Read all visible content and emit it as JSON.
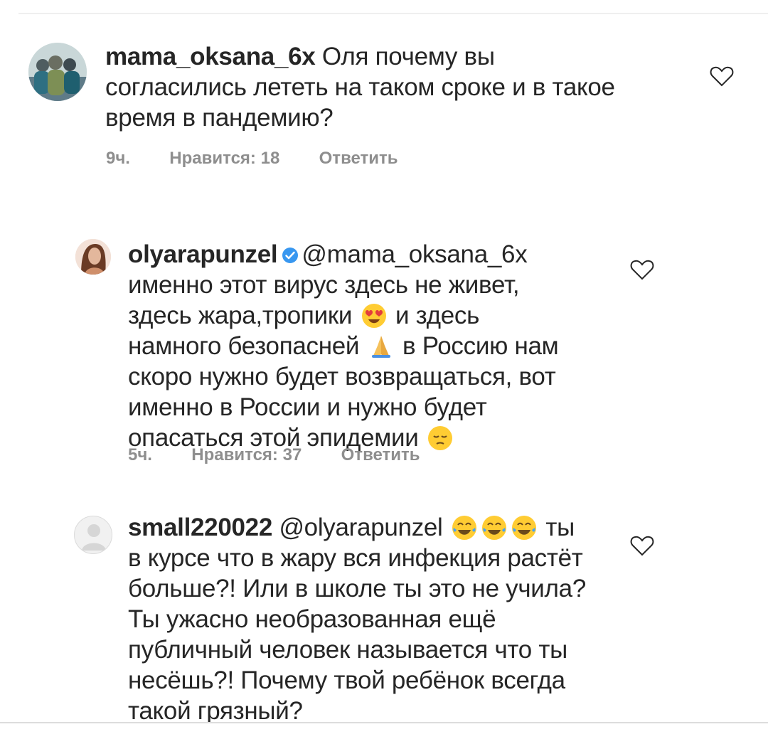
{
  "comments": [
    {
      "username": "mama_oksana_6x",
      "text_lines": [
        " Оля почему вы",
        "согласились лететь на таком сроке и в такое",
        "время в пандемию?"
      ],
      "time": "9ч.",
      "likes": "Нравится: 18",
      "reply": "Ответить",
      "avatar_icon": "profile-photo-group",
      "like_icon": "heart-outline-icon"
    },
    {
      "username": "olyarapunzel",
      "mention": "@mama_oksana_6x",
      "text_lines": [
        "именно этот вирус здесь не живет,",
        "здесь жара,тропики",
        "и здесь",
        "намного безопасней",
        "в Россию нам",
        "скоро нужно будет возвращаться, вот",
        "именно в России и нужно будет",
        "опасаться этой эпидемии"
      ],
      "time": "5ч.",
      "likes": "Нравится: 37",
      "reply": "Ответить",
      "avatar_icon": "profile-photo-woman",
      "verified_icon": "verified-badge-icon",
      "emojis": [
        "heart-eyes-emoji-icon",
        "folded-hands-emoji-icon",
        "pensive-face-emoji-icon"
      ],
      "like_icon": "heart-outline-icon"
    },
    {
      "username": "small220022",
      "mention": "@olyarapunzel",
      "text_lines": [
        "ты",
        "в курсе что в жару вся инфекция растёт",
        "больше?! Или в школе ты это не учила?",
        "Ты ужасно необразованная ещё",
        "публичный человек называется что ты",
        "несёшь?! Почему твой ребёнок всегда",
        "такой грязный?"
      ],
      "avatar_icon": "default-avatar-icon",
      "emojis": [
        "tears-of-joy-emoji-icon",
        "tears-of-joy-emoji-icon",
        "tears-of-joy-emoji-icon"
      ],
      "like_icon": "heart-outline-icon"
    }
  ],
  "colors": {
    "text": "#262626",
    "meta": "#8e8e8e",
    "verified": "#3897f0"
  }
}
